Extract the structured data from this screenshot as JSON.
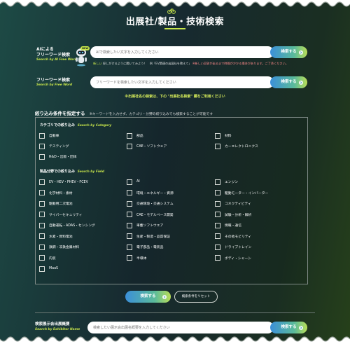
{
  "page": {
    "title": "出展社/製品・技術検索"
  },
  "ai_search": {
    "label_line1": "AIによる",
    "label_line2": "フリーワード検索",
    "label_sub": "Search by AI Free Word",
    "badge": "NEW",
    "placeholder": "AIで検索したい文字を入力してください",
    "button": "検索する",
    "hint_prefix": "新しい",
    "hint_main": "探しがけるように聞いてみよう！　例「EV関連の出展社を教えて」",
    "hint_note": "※新しい回答が出るまで時間がかかる場合があります。ご了承ください。"
  },
  "free_search": {
    "label": "フリーワード検索",
    "label_sub": "Search by Free Word",
    "placeholder": "フリーワードを検索したい文字を入力してください",
    "button": "検索する",
    "note": "※出展社名の検索は、下の \"出展社名検索\" 欄をご利用ください"
  },
  "filter": {
    "heading": "絞り込み条件を指定する",
    "heading_note": "※キーワードを入力せず、カテゴリ・分野の絞り込みでも検索することが可能です",
    "category_title": "カテゴリでの絞り込み",
    "category_sub": "Search by Category",
    "categories": [
      "自動車",
      "部品",
      "材料",
      "テスティング",
      "CAE・ソフトウェア",
      "カーエレクトロニクス",
      "R&D・出版・団体"
    ],
    "field_title": "製品分野での絞り込み",
    "field_sub": "Search by Field",
    "fields": [
      "EV・HEV・PHEV・FCEV",
      "AI",
      "エンジン",
      "化学材料・素材",
      "環境・エネルギー・資源",
      "駆動モーター・インバーター",
      "駆動用二次電池",
      "交通環境・交通システム",
      "コネクティビティ",
      "サイバーセキュリティ",
      "CAE・モデルベース開発",
      "試験・分析・解析",
      "自動運転・ADAS・センシング",
      "車載ソフトウエア",
      "情報・通信",
      "水素・燃料電池",
      "生産・製造・品質保証",
      "その他モビリティ",
      "鉄鋼・非鉄金属材料",
      "電子部品・電装品",
      "ドライブトレイン",
      "内装",
      "半導体",
      "ボディ・シャーシ",
      "MaaS"
    ]
  },
  "actions": {
    "search": "検索する",
    "reset": "検索条件をリセット"
  },
  "exhibitor": {
    "label": "検索展示会出展概要",
    "label_sub": "Search by Exhibitor Name",
    "placeholder": "検索したい展示会出展名概要を入力してください",
    "button": "検索する"
  },
  "colors": {
    "accent": "#c8e64b",
    "button_start": "#3b8fd9",
    "button_end": "#b9dd57"
  }
}
